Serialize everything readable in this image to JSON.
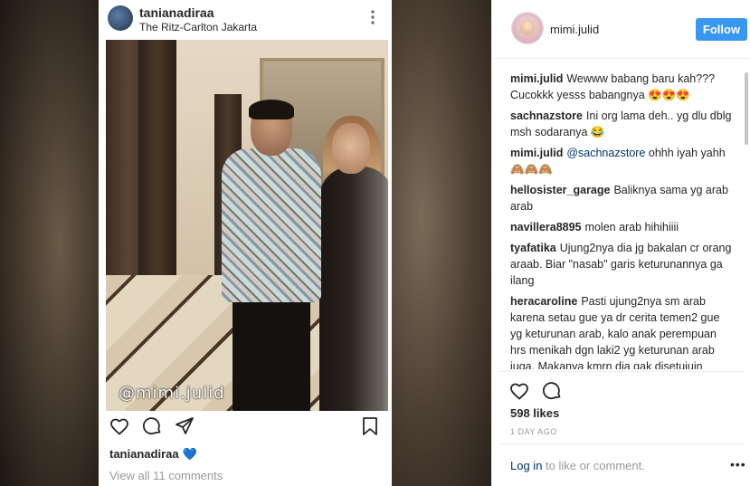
{
  "post": {
    "username": "tanianadiraa",
    "location": "The Ritz-Carlton Jakarta",
    "more_icon": "ellipsis-vertical-icon",
    "watermark": "@mimi.julid",
    "caption_username": "tanianadiraa",
    "caption_emoji": "💙",
    "view_all_comments": "View all 11 comments",
    "icons": [
      "heart-icon",
      "comment-icon",
      "share-icon",
      "bookmark-icon"
    ]
  },
  "side": {
    "username": "mimi.julid",
    "follow_label": "Follow",
    "comments": [
      {
        "user": "mimi.julid",
        "text": "Wewww babang baru kah??? Cucokkk yesss babangnya 😍😍😍"
      },
      {
        "user": "sachnazstore",
        "text": "Ini org lama deh.. yg dlu dblg msh sodaranya 😂"
      },
      {
        "user": "mimi.julid",
        "mention": "@sachnazstore",
        "text": "ohhh iyah yahh 🙈🙈🙈"
      },
      {
        "user": "hellosister_garage",
        "text": "Baliknya sama yg arab arab"
      },
      {
        "user": "navillera8895",
        "text": "molen arab hihihiiii"
      },
      {
        "user": "tyafatika",
        "text": "Ujung2nya dia jg bakalan cr orang araab. Biar \"nasab\" garis keturunannya ga ilang"
      },
      {
        "user": "heracaroline",
        "text": "Pasti ujung2nya sm arab karena setau gue ya dr cerita temen2 gue yg keturunan arab, kalo anak perempuan hrs menikah dgn laki2 yg keturunan arab juga. Makanya kmrn dia gak disetujuin bgtbgt kannn krn TK kan bukan arab"
      }
    ],
    "likes": "598 likes",
    "date": "1 DAY AGO",
    "login_link": "Log in",
    "login_rest": " to like or comment.",
    "more": "•••"
  }
}
